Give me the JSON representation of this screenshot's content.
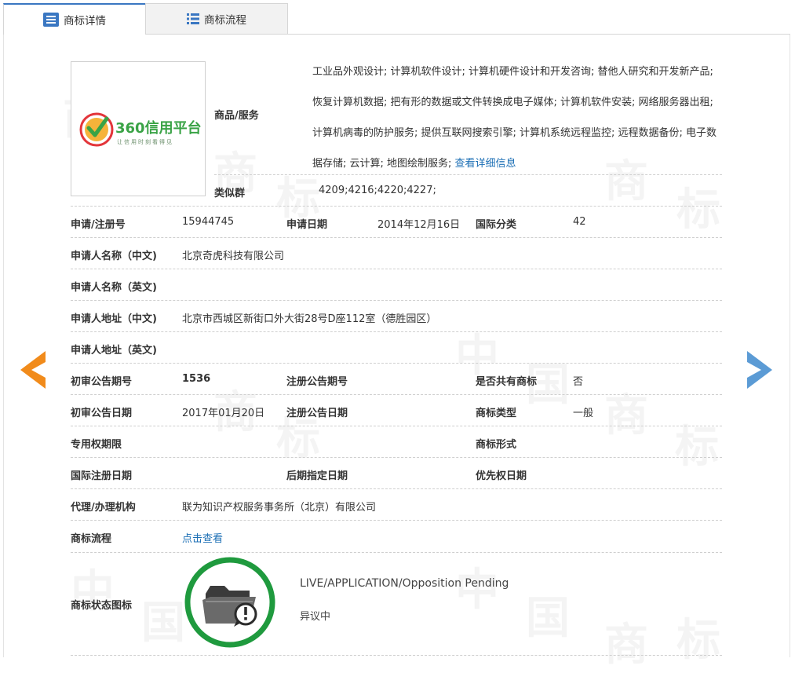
{
  "tabs": [
    {
      "label": "商标详情"
    },
    {
      "label": "商标流程"
    }
  ],
  "logo": {
    "brand_text": "360信用平台",
    "slogan": "让信用时刻看得见"
  },
  "goods": {
    "label": "商品/服务",
    "text": "工业品外观设计; 计算机软件设计; 计算机硬件设计和开发咨询; 替他人研究和开发新产品; 恢复计算机数据; 把有形的数据或文件转换成电子媒体; 计算机软件安装; 网络服务器出租; 计算机病毒的防护服务; 提供互联网搜索引擎; 计算机系统远程监控; 远程数据备份; 电子数据存储; 云计算; 地图绘制服务; ",
    "link": "查看详细信息"
  },
  "similar": {
    "label": "类似群",
    "value": "4209;4216;4220;4227;"
  },
  "fields": {
    "reg_no_label": "申请/注册号",
    "reg_no": "15944745",
    "apply_date_label": "申请日期",
    "apply_date": "2014年12月16日",
    "intl_class_label": "国际分类",
    "intl_class": "42",
    "applicant_cn_label": "申请人名称（中文)",
    "applicant_cn": "北京奇虎科技有限公司",
    "applicant_en_label": "申请人名称（英文)",
    "applicant_en": "",
    "address_cn_label": "申请人地址（中文)",
    "address_cn": "北京市西城区新街口外大街28号D座112室（德胜园区）",
    "address_en_label": "申请人地址（英文)",
    "address_en": "",
    "prelim_no_label": "初审公告期号",
    "prelim_no": "1536",
    "reg_pub_no_label": "注册公告期号",
    "reg_pub_no": "",
    "shared_label": "是否共有商标",
    "shared": "否",
    "prelim_date_label": "初审公告日期",
    "prelim_date": "2017年01月20日",
    "reg_pub_date_label": "注册公告日期",
    "reg_pub_date": "",
    "tm_type_label": "商标类型",
    "tm_type": "一般",
    "exclusive_label": "专用权期限",
    "exclusive": "",
    "tm_form_label": "商标形式",
    "tm_form": "",
    "intl_reg_date_label": "国际注册日期",
    "intl_reg_date": "",
    "later_date_label": "后期指定日期",
    "later_date": "",
    "priority_date_label": "优先权日期",
    "priority_date": "",
    "agent_label": "代理/办理机构",
    "agent": "联为知识产权服务事务所（北京）有限公司",
    "flow_label": "商标流程",
    "flow_link": "点击查看"
  },
  "status": {
    "label": "商标状态图标",
    "en": "LIVE/APPLICATION/Opposition Pending",
    "zh": "异议中",
    "ring_color": "#1f9a3e"
  },
  "watermark": {
    "chars": [
      "中",
      "国",
      "商",
      "标"
    ]
  },
  "colors": {
    "accent": "#3a77c2",
    "link": "#1c6fb5",
    "arrow_left": "#f18b1b",
    "arrow_right": "#5b9bd5"
  }
}
